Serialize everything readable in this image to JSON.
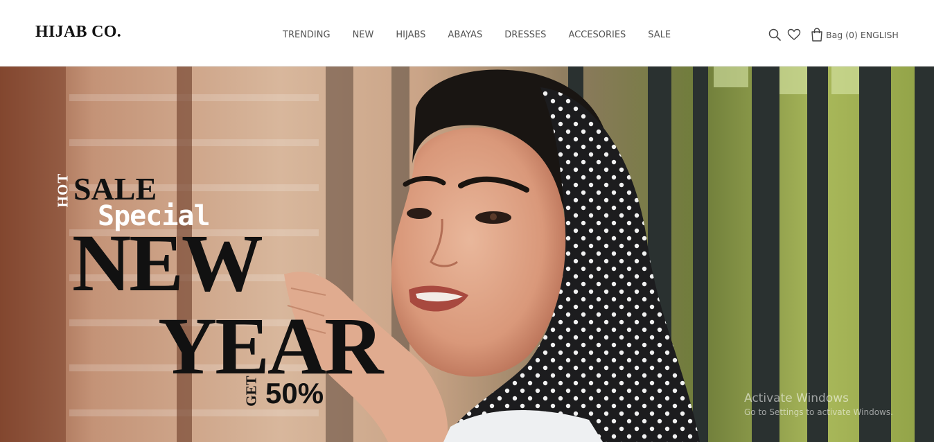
{
  "header": {
    "logo": "HIJAB CO.",
    "nav": [
      {
        "label": "TRENDING"
      },
      {
        "label": "NEW"
      },
      {
        "label": "HIJABS"
      },
      {
        "label": "ABAYAS"
      },
      {
        "label": "DRESSES"
      },
      {
        "label": "ACCESORIES"
      },
      {
        "label": "SALE"
      }
    ],
    "tools": {
      "search_icon": "search-icon",
      "wishlist_icon": "heart-icon",
      "bag_icon": "shopping-bag-icon",
      "bag_label": "Bag (0)",
      "language": "ENGLISH"
    }
  },
  "hero": {
    "hot": "HOT",
    "sale": "SALE",
    "special": "Special",
    "new": "NEW",
    "year": "YEAR",
    "get": "GET",
    "discount": "50%"
  },
  "watermark": {
    "title": "Activate Windows",
    "subtitle": "Go to Settings to activate Windows."
  },
  "colors": {
    "text_dark": "#111111",
    "nav_text": "#555555",
    "header_bg": "#ffffff"
  }
}
